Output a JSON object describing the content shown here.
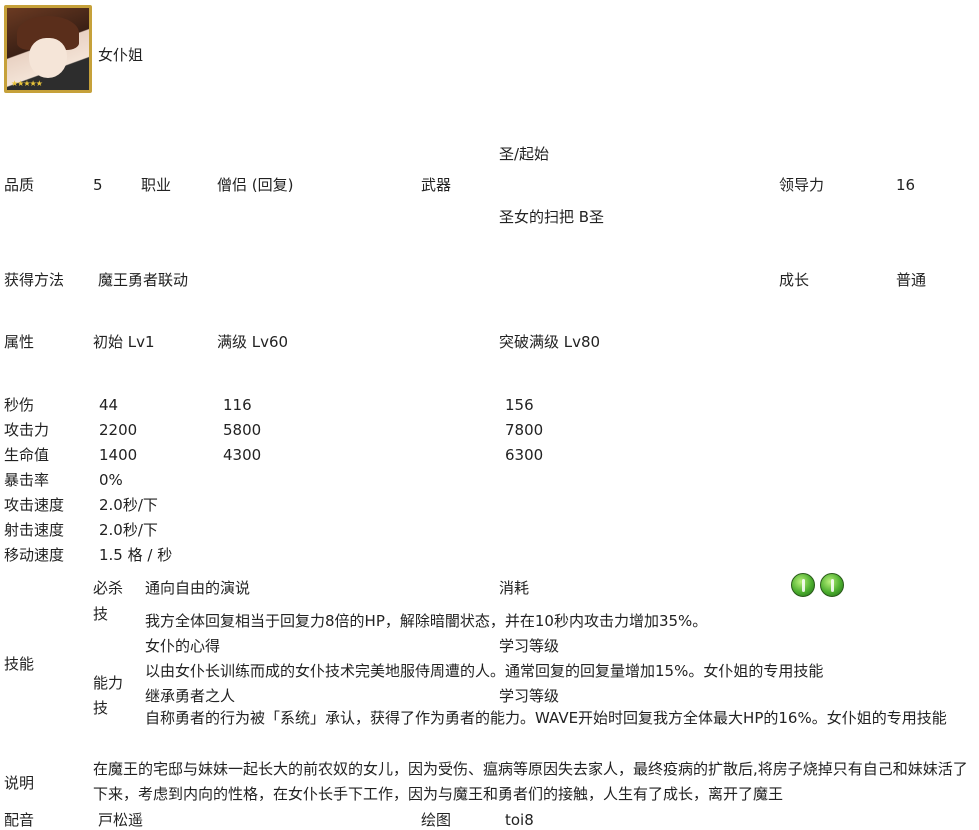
{
  "character": {
    "name": "女仆姐",
    "avatar_stars": "★★★★★"
  },
  "row1": {
    "quality_label": "品质",
    "quality_value": "5",
    "class_label": "职业",
    "class_value": "僧侣 (回复)",
    "weapon_label": "武器",
    "weapon_type": "圣/起始",
    "weapon_name": "圣女的扫把 B圣",
    "leadership_label": "领导力",
    "leadership_value": "16"
  },
  "row2": {
    "obtain_label": "获得方法",
    "obtain_value": "魔王勇者联动",
    "growth_label": "成长",
    "growth_value": "普通"
  },
  "attr_header": {
    "label": "属性",
    "lv1": "初始 Lv1",
    "lv60": "满级 Lv60",
    "lv80": "突破满级 Lv80"
  },
  "stats": [
    {
      "label": "秒伤",
      "lv1": "44",
      "lv60": "116",
      "lv80": "156"
    },
    {
      "label": "攻击力",
      "lv1": "2200",
      "lv60": "5800",
      "lv80": "7800"
    },
    {
      "label": "生命值",
      "lv1": "1400",
      "lv60": "4300",
      "lv80": "6300"
    },
    {
      "label": "暴击率",
      "lv1": "0%"
    },
    {
      "label": "攻击速度",
      "lv1": "2.0秒/下"
    },
    {
      "label": "射击速度",
      "lv1": "2.0秒/下"
    },
    {
      "label": "移动速度",
      "lv1": "1.5 格 / 秒"
    }
  ],
  "skills": {
    "label": "技能",
    "special_label_1": "必杀",
    "special_label_2": "技",
    "special_name": "通向自由的演说",
    "cost_label": "消耗",
    "special_desc": "我方全体回复相当于回复力8倍的HP，解除暗闇状态，并在10秒内攻击力增加35%。",
    "ability_label_1": "能力",
    "ability_label_2": "技",
    "ability1_name": "女仆的心得",
    "ability1_level_label": "学习等级",
    "ability1_desc": "以由女仆长训练而成的女仆技术完美地服侍周遭的人。通常回复的回复量增加15%。女仆姐的专用技能",
    "ability2_name": "继承勇者之人",
    "ability2_level_label": "学习等级",
    "ability2_desc": "自称勇者的行为被「系统」承认，获得了作为勇者的能力。WAVE开始时回复我方全体最大HP的16%。女仆姐的专用技能"
  },
  "description": {
    "label": "说明",
    "text": " 在魔王的宅邸与妹妹一起长大的前农奴的女儿，因为受伤、瘟病等原因失去家人，最终疫病的扩散后,将房子烧掉只有自己和妹妹活了下来，考虑到内向的性格，在女仆长手下工作，因为与魔王和勇者们的接触，人生有了成长，离开了魔王"
  },
  "credits": {
    "voice_label": "配音",
    "voice_value": "戸松遥",
    "art_label": "绘图",
    "art_value": "toi8"
  }
}
